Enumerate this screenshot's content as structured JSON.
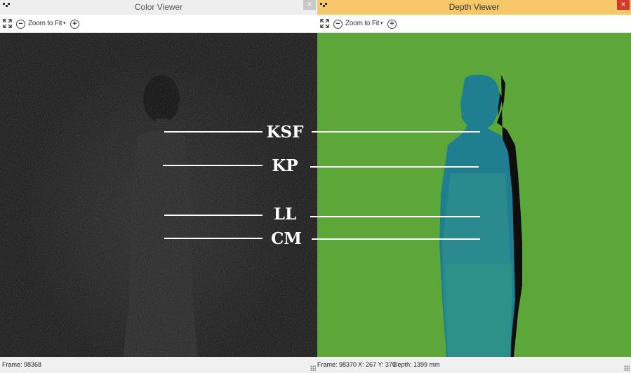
{
  "color_viewer": {
    "title": "Color Viewer",
    "close_label": "×",
    "toolbar": {
      "fit_icon": "expand-icon",
      "zoom_out_label": "−",
      "zoom_label": "Zoom to Fit",
      "caret": "▾",
      "zoom_in_label": "+"
    },
    "status": {
      "frame": "Frame: 98368"
    }
  },
  "depth_viewer": {
    "title": "Depth Viewer",
    "close_label": "×",
    "toolbar": {
      "fit_icon": "expand-icon",
      "zoom_out_label": "−",
      "zoom_label": "Zoom to Fit",
      "caret": "▾",
      "zoom_in_label": "+"
    },
    "status": {
      "frame": "Frame: 98370",
      "coords": "X: 267 Y: 370",
      "depth": "Depth: 1399 mm"
    },
    "colors": {
      "background": "#5aa63a",
      "body": "#2a8a8c",
      "shadow": "#0d0d0d"
    }
  },
  "annotations": [
    {
      "label": "KSF"
    },
    {
      "label": "KP"
    },
    {
      "label": "LL"
    },
    {
      "label": "CM"
    }
  ]
}
